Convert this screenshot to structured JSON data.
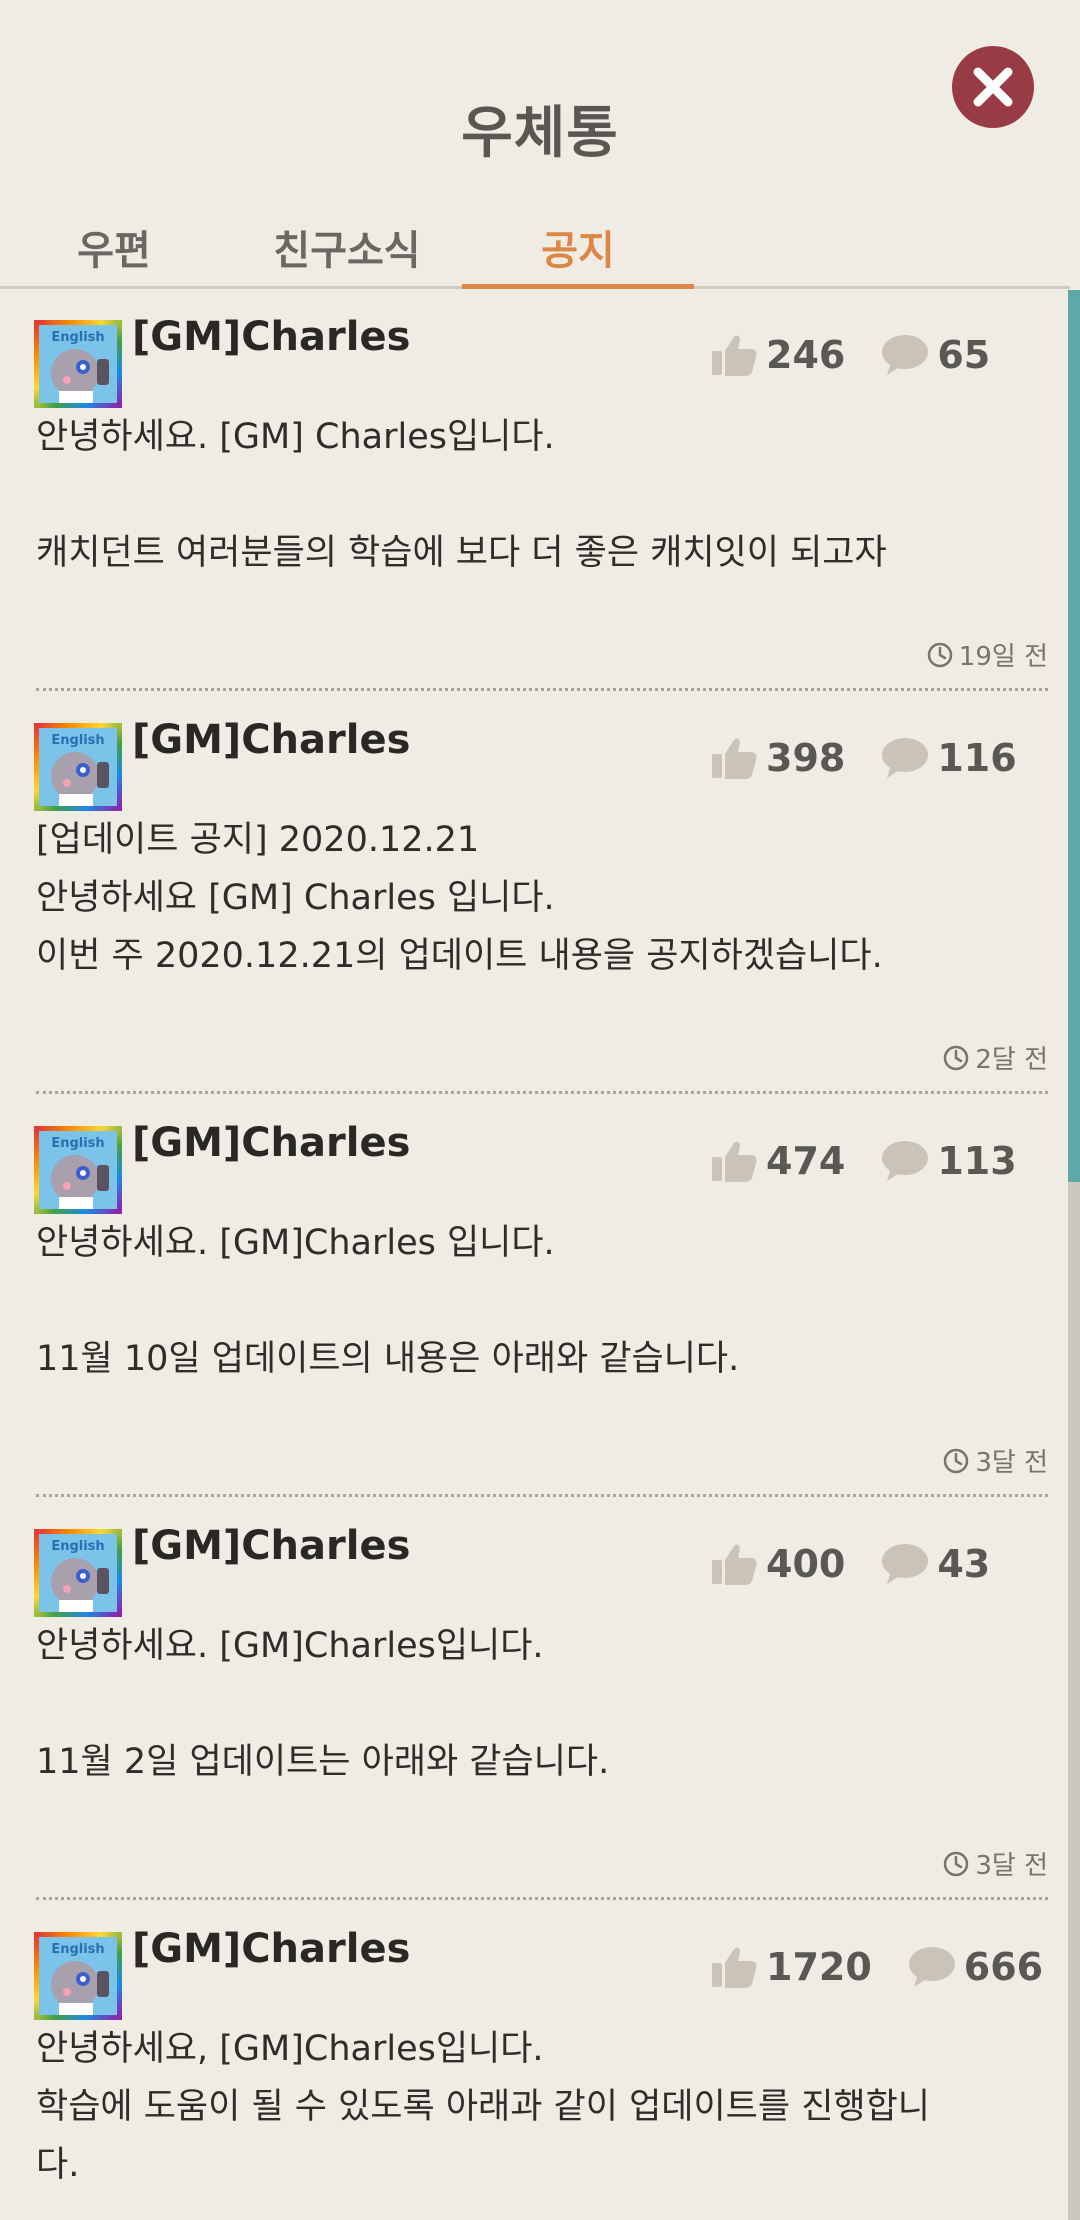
{
  "header": {
    "title": "우체통",
    "close_icon": "close-icon"
  },
  "tabs": [
    {
      "label": "우편",
      "active": false
    },
    {
      "label": "친구소식",
      "active": false
    },
    {
      "label": "공지",
      "active": true
    }
  ],
  "colors": {
    "background": "#efece3",
    "accent": "#dd8648",
    "close_button": "#993b45",
    "scrollbar": "#5ea9a8"
  },
  "posts": [
    {
      "author": "[GM]Charles",
      "likes": "246",
      "comments": "65",
      "body": "안녕하세요. [GM] Charles입니다.\n\n캐치던트 여러분들의 학습에 보다 더 좋은 캐치잇이 되고자",
      "time": "19일 전"
    },
    {
      "author": "[GM]Charles",
      "likes": "398",
      "comments": "116",
      "body": "[업데이트 공지] 2020.12.21\n안녕하세요 [GM] Charles 입니다.\n이번 주 2020.12.21의 업데이트 내용을 공지하겠습니다.",
      "time": "2달 전"
    },
    {
      "author": "[GM]Charles",
      "likes": "474",
      "comments": "113",
      "body": "안녕하세요. [GM]Charles 입니다.\n\n11월 10일 업데이트의 내용은 아래와 같습니다.",
      "time": "3달 전"
    },
    {
      "author": "[GM]Charles",
      "likes": "400",
      "comments": "43",
      "body": "안녕하세요. [GM]Charles입니다.\n\n11월 2일 업데이트는 아래와 같습니다.",
      "time": "3달 전"
    },
    {
      "author": "[GM]Charles",
      "likes": "1720",
      "comments": "666",
      "body": "안녕하세요, [GM]Charles입니다.\n학습에 도움이 될 수 있도록 아래과 같이 업데이트를 진행합니\n다.",
      "time": ""
    }
  ],
  "icons": {
    "like": "thumbs-up-icon",
    "comment": "speech-bubble-icon",
    "time": "clock-icon",
    "avatar": "robot-avatar"
  }
}
